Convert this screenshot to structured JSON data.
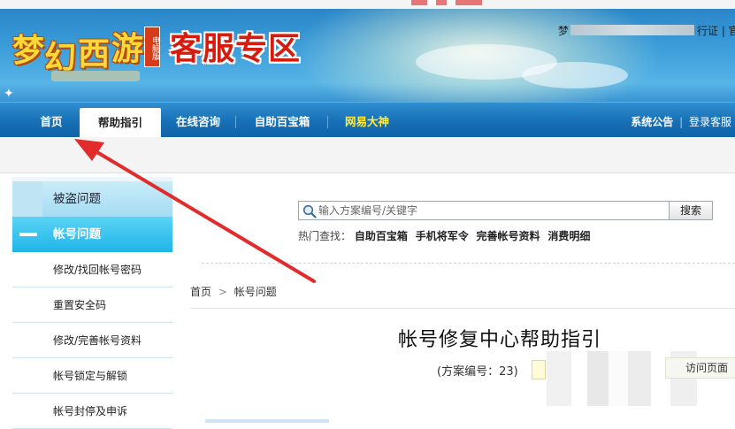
{
  "header": {
    "game_logo_text": [
      "梦",
      "幻",
      "西",
      "游"
    ],
    "edition_badge": "电脑版",
    "zone_title": "客服专区",
    "user_prefix": "梦",
    "user_links": "行证 | 官"
  },
  "nav": {
    "items": [
      "首页",
      "帮助指引",
      "在线咨询",
      "自助百宝箱",
      "网易大神"
    ],
    "active_index": 1,
    "right_notice": "系统公告",
    "right_sep": "|",
    "right_login": "登录客服"
  },
  "sidebar": {
    "categories": [
      "被盗问题",
      "帐号问题"
    ],
    "active_category": "帐号问题",
    "subitems": [
      "修改/找回帐号密码",
      "重置安全码",
      "修改/完善帐号资料",
      "帐号锁定与解锁",
      "帐号封停及申诉"
    ]
  },
  "search": {
    "placeholder": "输入方案编号/关键字",
    "button_label": "搜索",
    "hot_label": "热门查找：",
    "hot_links": [
      "自助百宝箱",
      "手机将军令",
      "完善帐号资料",
      "消费明细"
    ]
  },
  "breadcrumb": {
    "home": "首页",
    "separator": ">",
    "current": "帐号问题"
  },
  "article": {
    "title": "帐号修复中心帮助指引",
    "meta": "(方案编号：23)",
    "back_link": "访问页面"
  },
  "colors": {
    "nav_bg": "#176fb5",
    "active_sidebar": "#1fb5e8",
    "zone_title": "#d51c0e",
    "annotation_arrow": "#e22b2b",
    "highlight_nav": "#ffec3d"
  }
}
